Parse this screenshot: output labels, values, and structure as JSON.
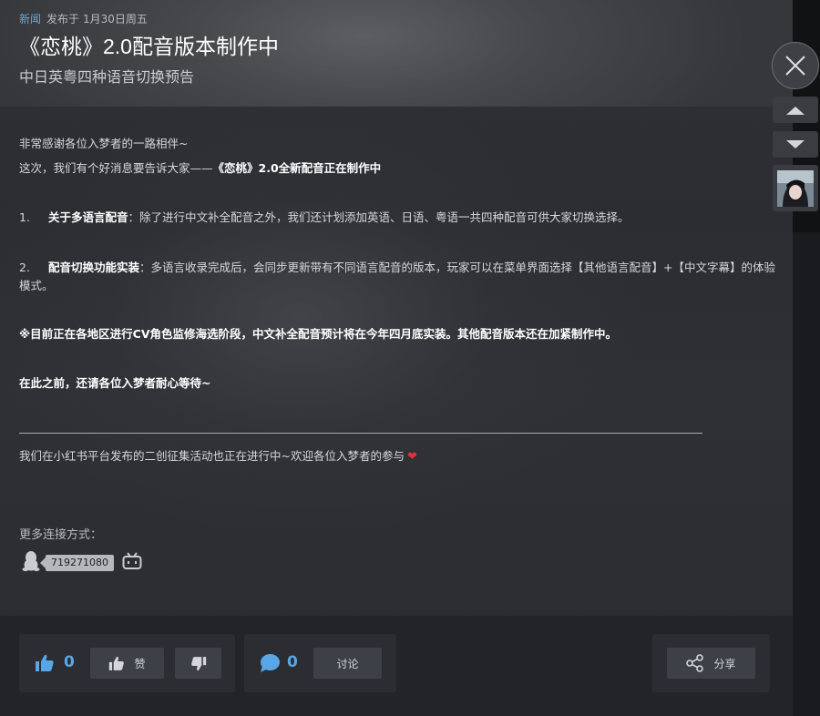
{
  "meta": {
    "tag": "新闻",
    "posted_label": "发布于",
    "date": "1月30日周五"
  },
  "title": "《恋桃》2.0配音版本制作中",
  "subtitle": "中日英粤四种语音切换预告",
  "body": {
    "line1": "非常感谢各位入梦者的一路相伴~",
    "line2_prefix": "这次，我们有个好消息要告诉大家——",
    "line2_bold": "《恋桃》2.0全新配音正在制作中",
    "item1_num": "1.",
    "item1_bold": "关于多语言配音",
    "item1_text": "：除了进行中文补全配音之外，我们还计划添加英语、日语、粤语一共四种配音可供大家切换选择。",
    "item2_num": "2.",
    "item2_bold": "配音切换功能实装",
    "item2_text": "：多语言收录完成后，会同步更新带有不同语言配音的版本，玩家可以在菜单界面选择【其他语言配音】+【中文字幕】的体验模式。",
    "notice": "※目前正在各地区进行CV角色监修海选阶段，中文补全配音预计将在今年四月底实装。其他配音版本还在加紧制作中。",
    "wait": "在此之前，还请各位入梦者耐心等待~",
    "xhs": "我们在小红书平台发布的二创征集活动也正在进行中~欢迎各位入梦者的参与"
  },
  "contacts": {
    "label": "更多连接方式：",
    "qq_number": "719271080"
  },
  "footer": {
    "like_count": "0",
    "like_label": "赞",
    "comment_count": "0",
    "discuss_label": "讨论",
    "share_label": "分享"
  },
  "colors": {
    "accent_blue": "#59a6e6",
    "heart_red": "#e0303a"
  }
}
